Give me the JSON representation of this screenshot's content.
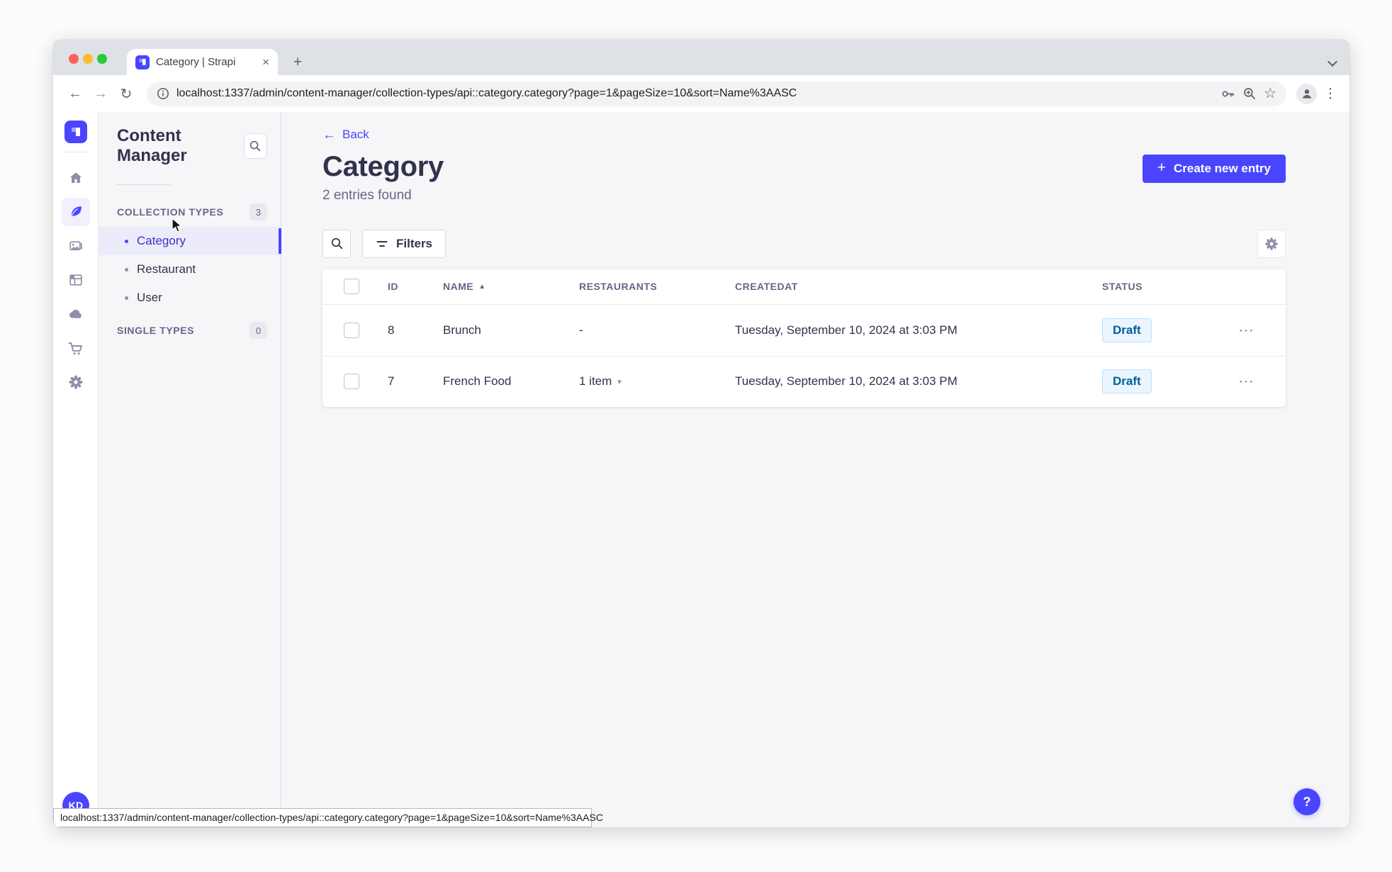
{
  "browser": {
    "tab_title": "Category | Strapi",
    "url": "localhost:1337/admin/content-manager/collection-types/api::category.category?page=1&pageSize=10&sort=Name%3AASC",
    "status_url": "localhost:1337/admin/content-manager/collection-types/api::category.category?page=1&pageSize=10&sort=Name%3AASC"
  },
  "icons": {
    "back_arrow": "←",
    "forward_arrow": "→",
    "reload": "↻",
    "star": "☆",
    "dots_vertical": "⋮",
    "ellipsis": "⋯",
    "close": "×",
    "plus": "+",
    "sort_asc": "▲",
    "caret_down": "▾"
  },
  "sidebar": {
    "title": "Content Manager",
    "collection_types_label": "COLLECTION TYPES",
    "collection_types_count": "3",
    "items": [
      {
        "label": "Category",
        "active": true
      },
      {
        "label": "Restaurant",
        "active": false
      },
      {
        "label": "User",
        "active": false
      }
    ],
    "single_types_label": "SINGLE TYPES",
    "single_types_count": "0"
  },
  "header": {
    "back": "Back",
    "title": "Category",
    "subtitle": "2 entries found",
    "create_button": "Create new entry"
  },
  "toolbar": {
    "filters": "Filters"
  },
  "table": {
    "headers": {
      "id": "ID",
      "name": "NAME",
      "restaurants": "RESTAURANTS",
      "createdat": "CREATEDAT",
      "status": "STATUS"
    },
    "rows": [
      {
        "id": "8",
        "name": "Brunch",
        "restaurants": "-",
        "createdat": "Tuesday, September 10, 2024 at 3:03 PM",
        "status": "Draft"
      },
      {
        "id": "7",
        "name": "French Food",
        "restaurants": "1 item",
        "createdat": "Tuesday, September 10, 2024 at 3:03 PM",
        "status": "Draft"
      }
    ]
  },
  "user": {
    "initials": "KD"
  },
  "help": {
    "label": "?"
  },
  "colors": {
    "accent": "#4945ff",
    "active_item_bg": "#ecebfa",
    "draft_bg": "#eaf5ff",
    "draft_border": "#b8e1ff",
    "draft_text": "#006096",
    "page_bg": "#f6f6f9"
  }
}
